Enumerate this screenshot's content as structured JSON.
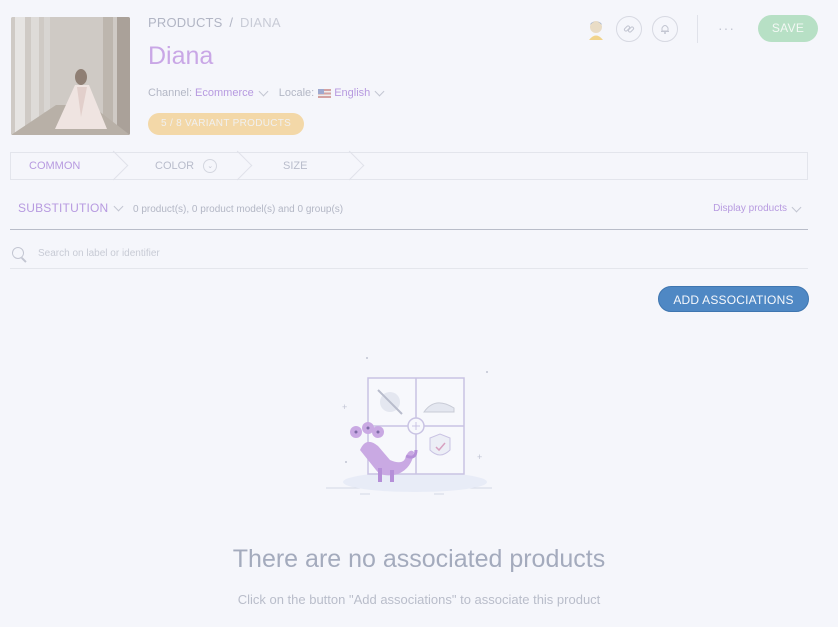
{
  "header": {
    "breadcrumb": {
      "root": "PRODUCTS",
      "separator": "/",
      "current": "DIANA"
    },
    "title": "Diana",
    "channel": {
      "label": "Channel:",
      "value": "Ecommerce"
    },
    "locale": {
      "label": "Locale:",
      "value": "English",
      "flag": "us-flag-icon"
    },
    "variant_badge": "5 / 8 VARIANT PRODUCTS",
    "actions": {
      "more_label": "···",
      "save_label": "SAVE",
      "icons": [
        "user-avatar-icon",
        "link-icon",
        "bell-icon"
      ]
    }
  },
  "tabs": {
    "items": [
      {
        "label": "COMMON",
        "active": true
      },
      {
        "label": "COLOR",
        "active": false
      },
      {
        "label": "SIZE",
        "active": false
      }
    ]
  },
  "associations": {
    "type_label": "SUBSTITUTION",
    "count_text": "0 product(s), 0 product model(s) and 0 group(s)",
    "display_label": "Display products"
  },
  "search": {
    "placeholder": "Search on label or identifier"
  },
  "add_button_label": "ADD ASSOCIATIONS",
  "empty_state": {
    "title": "There are no associated products",
    "subtitle": "Click on the button \"Add associations\" to associate this product"
  },
  "colors": {
    "accent_purple": "#b79ae0",
    "primary_blue": "#4f88c4",
    "save_green": "#b7e0c5",
    "badge_orange": "#f3d8a8"
  }
}
